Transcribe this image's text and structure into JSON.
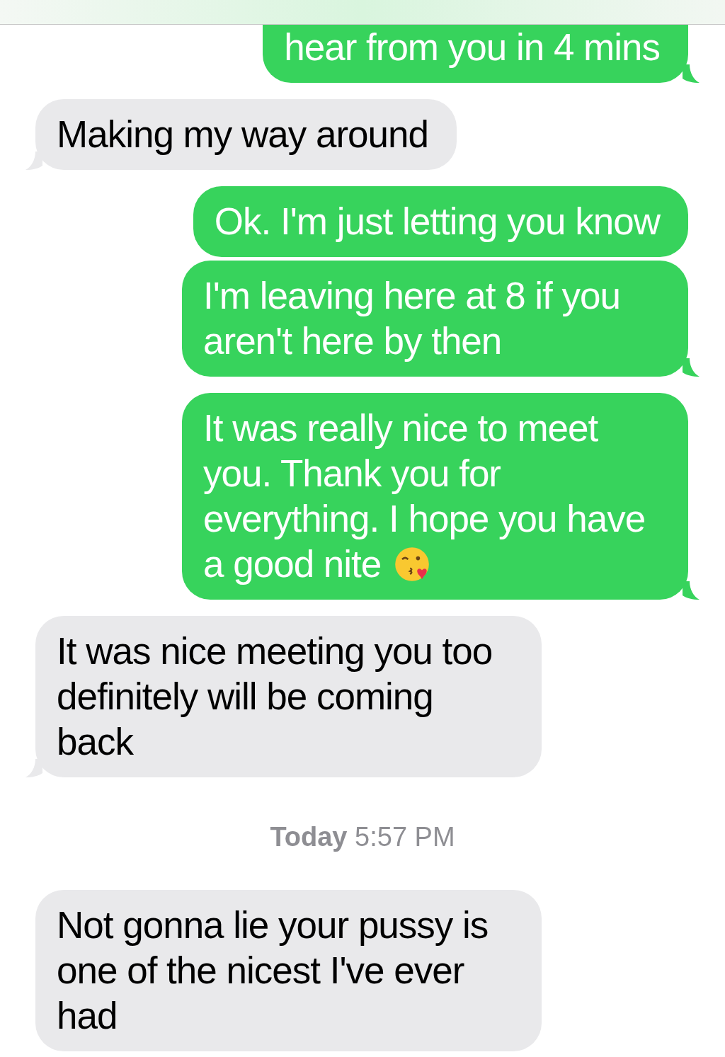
{
  "messages": [
    {
      "kind": "sent",
      "text": "hear from you in 4 mins",
      "tail": true
    },
    {
      "kind": "received",
      "text": "Making my way around",
      "tail": true
    },
    {
      "kind": "sent",
      "text": "Ok. I'm just letting you know",
      "tail": false
    },
    {
      "kind": "sent",
      "text": "I'm leaving here at 8 if you aren't here by then",
      "tail": true
    },
    {
      "kind": "sent",
      "text": "It was really nice to meet you. Thank you for everything. I hope you have a good nite",
      "emoji": true,
      "tail": true
    },
    {
      "kind": "received",
      "text": "It was nice meeting you too definitely will be coming back",
      "tail": true
    },
    {
      "kind": "timestamp",
      "text": "**Today** 5:57 PM"
    },
    {
      "kind": "received",
      "text": "Not gonna lie your pussy is one of the nicest I've ever had",
      "tail": false
    }
  ]
}
